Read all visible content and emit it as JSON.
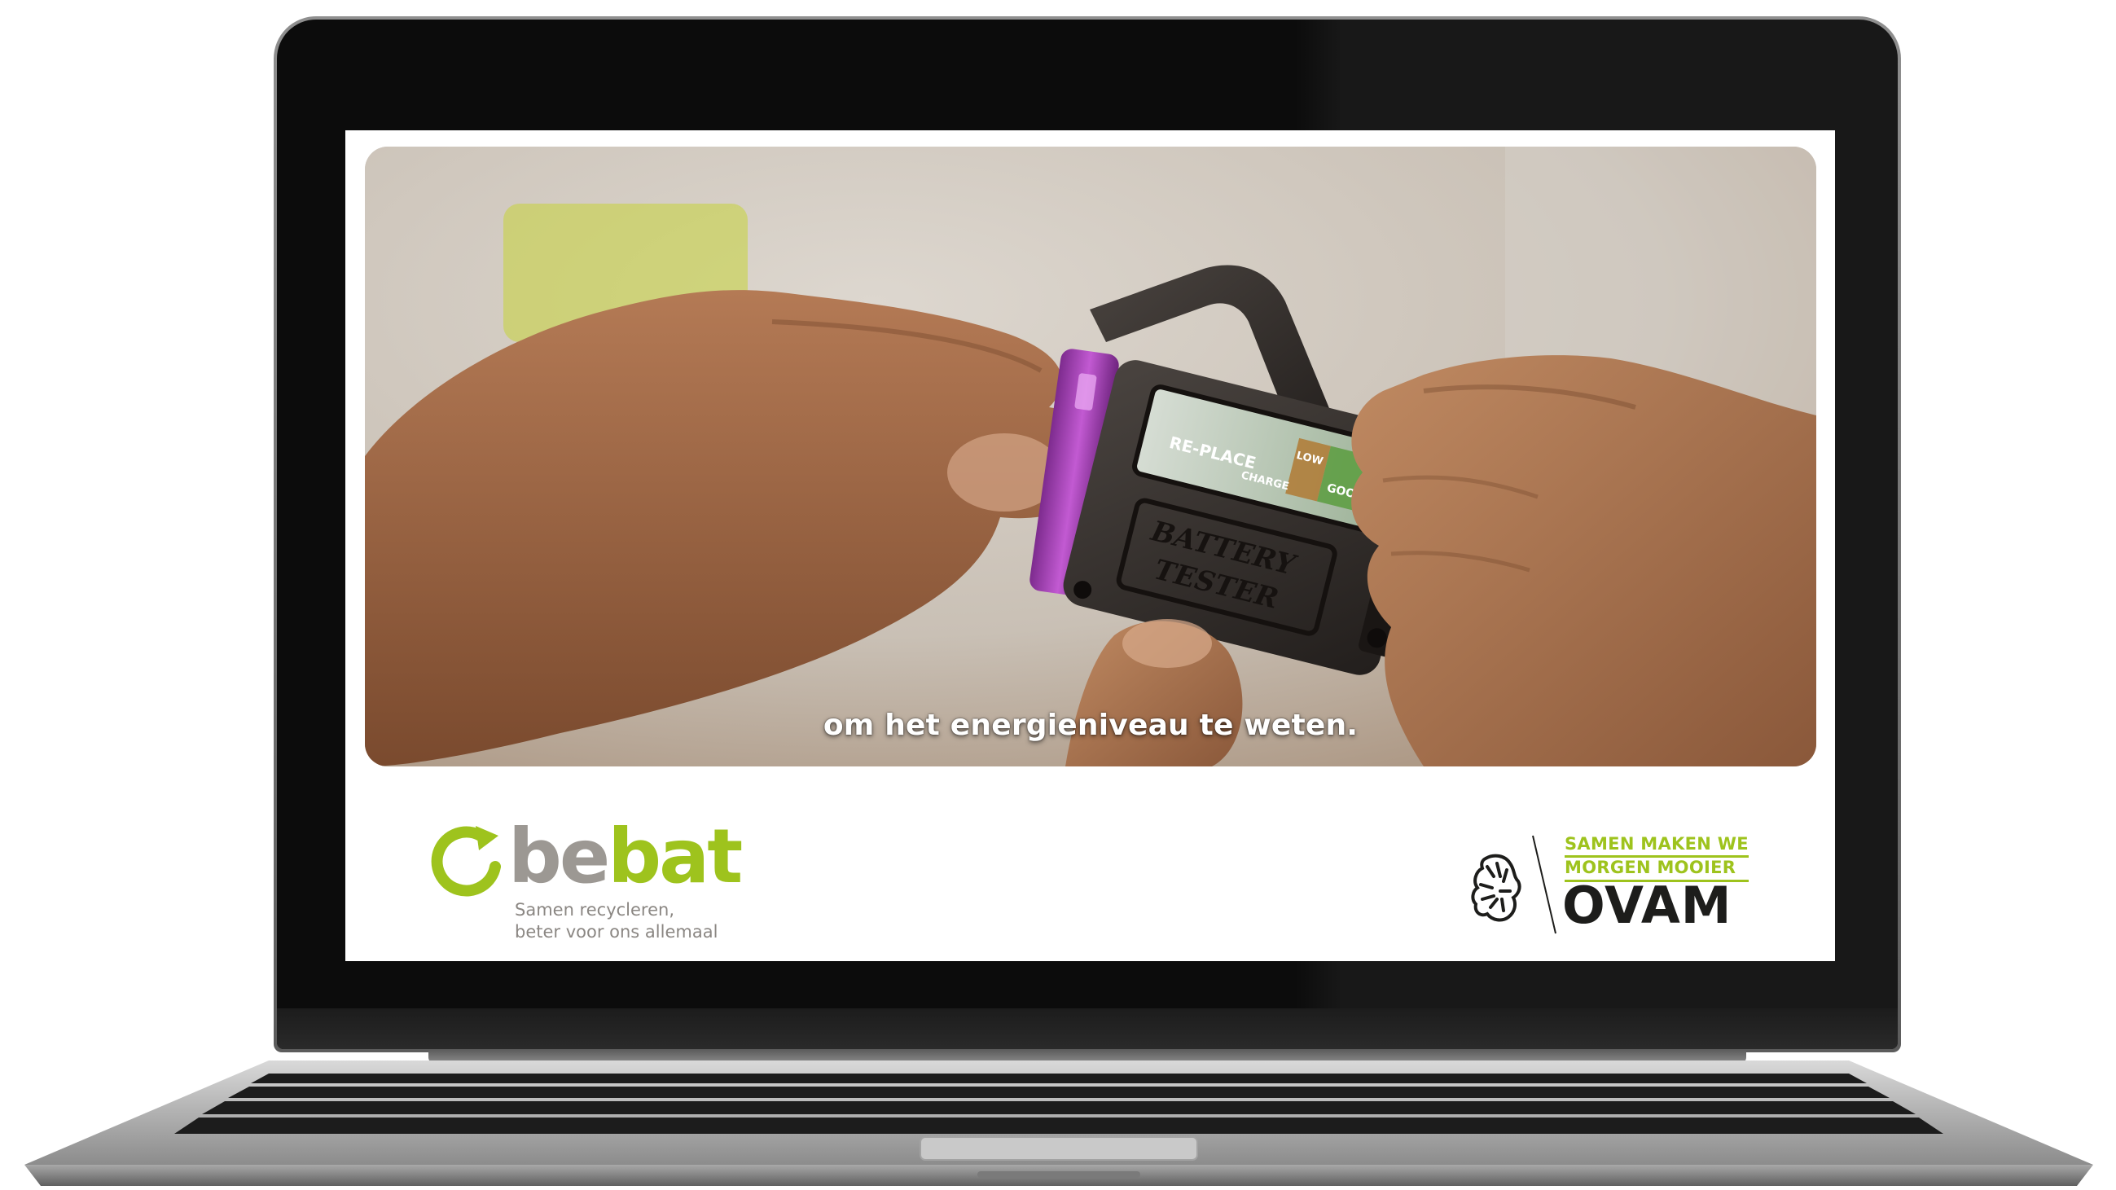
{
  "video": {
    "subtitle": "om het energieniveau te weten.",
    "tester_label_top": "BATTERY",
    "tester_label_bottom": "TESTER",
    "gauge_replace": "RE-PLACE",
    "gauge_recharge": "CHARGE",
    "gauge_low": "LOW",
    "gauge_good": "GOOD"
  },
  "bebat": {
    "word_be": "be",
    "word_bat": "bat",
    "tagline_line1": "Samen recycleren,",
    "tagline_line2": "beter voor ons allemaal"
  },
  "ovam": {
    "slogan_line1": "SAMEN MAKEN WE",
    "slogan_line2": "MORGEN MOOIER",
    "name": "OVAM"
  },
  "colors": {
    "bebat_green": "#9ec31d",
    "bebat_grey": "#9c9893",
    "ovam_green": "#9ec31d",
    "ovam_black": "#1d1d1b",
    "bezel": "#0c0c0c"
  }
}
